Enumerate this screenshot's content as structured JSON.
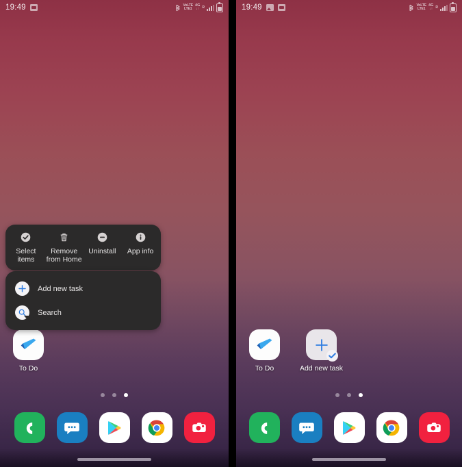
{
  "meta": {
    "accent_blue": "#2f7de1",
    "menu_bg": "#2b2a2a",
    "wallpaper_top": "#8e3145",
    "wallpaper_bottom": "#43304f"
  },
  "left_panel": {
    "status_bar": {
      "time": "19:49",
      "notification_icons": [
        "badge-notification-icon"
      ],
      "system_icons": [
        "bluetooth-icon",
        "volte-icon",
        "4g-icon",
        "signal-bars-icon",
        "battery-icon"
      ],
      "volte_label_top": "VoLTE",
      "volte_label_bottom": "LTE1",
      "network_label": "4G",
      "network_sub": "↓↑",
      "roaming_label": "R"
    },
    "action_bar": {
      "items": [
        {
          "label": "Select items",
          "icon": "check-circle-icon"
        },
        {
          "label": "Remove from Home",
          "icon": "trash-icon"
        },
        {
          "label": "Uninstall",
          "icon": "minus-circle-icon"
        },
        {
          "label": "App info",
          "icon": "info-circle-icon"
        }
      ]
    },
    "shortcut_menu": {
      "items": [
        {
          "label": "Add new task",
          "icon": "plus-icon"
        },
        {
          "label": "Search",
          "icon": "search-icon"
        }
      ]
    },
    "home_icons": [
      {
        "label": "To Do",
        "icon": "todo-check-icon"
      }
    ],
    "page_indicator": {
      "count": 3,
      "active_index": 2
    },
    "dock": [
      {
        "label": "Phone",
        "icon": "phone-icon",
        "color": "#21b25c"
      },
      {
        "label": "Messages",
        "icon": "messages-icon",
        "color": "#1a7fc1"
      },
      {
        "label": "Play Store",
        "icon": "play-store-icon",
        "color": "#ffffff"
      },
      {
        "label": "Chrome",
        "icon": "chrome-icon",
        "color": "#ffffff"
      },
      {
        "label": "Camera",
        "icon": "camera-icon",
        "color": "#f1213f"
      }
    ]
  },
  "right_panel": {
    "status_bar": {
      "time": "19:49",
      "notification_icons": [
        "image-notification-icon",
        "badge-notification-icon"
      ],
      "system_icons": [
        "bluetooth-icon",
        "volte-icon",
        "4g-icon",
        "signal-bars-icon",
        "battery-icon"
      ],
      "volte_label_top": "VoLTE",
      "volte_label_bottom": "LTE1",
      "network_label": "4G",
      "network_sub": "↓↑",
      "roaming_label": "R"
    },
    "home_icons": [
      {
        "label": "To Do",
        "icon": "todo-check-icon"
      },
      {
        "label": "Add new task",
        "icon": "add-task-icon"
      }
    ],
    "page_indicator": {
      "count": 3,
      "active_index": 2
    },
    "dock": [
      {
        "label": "Phone",
        "icon": "phone-icon",
        "color": "#21b25c"
      },
      {
        "label": "Messages",
        "icon": "messages-icon",
        "color": "#1a7fc1"
      },
      {
        "label": "Play Store",
        "icon": "play-store-icon",
        "color": "#ffffff"
      },
      {
        "label": "Chrome",
        "icon": "chrome-icon",
        "color": "#ffffff"
      },
      {
        "label": "Camera",
        "icon": "camera-icon",
        "color": "#f1213f"
      }
    ]
  }
}
